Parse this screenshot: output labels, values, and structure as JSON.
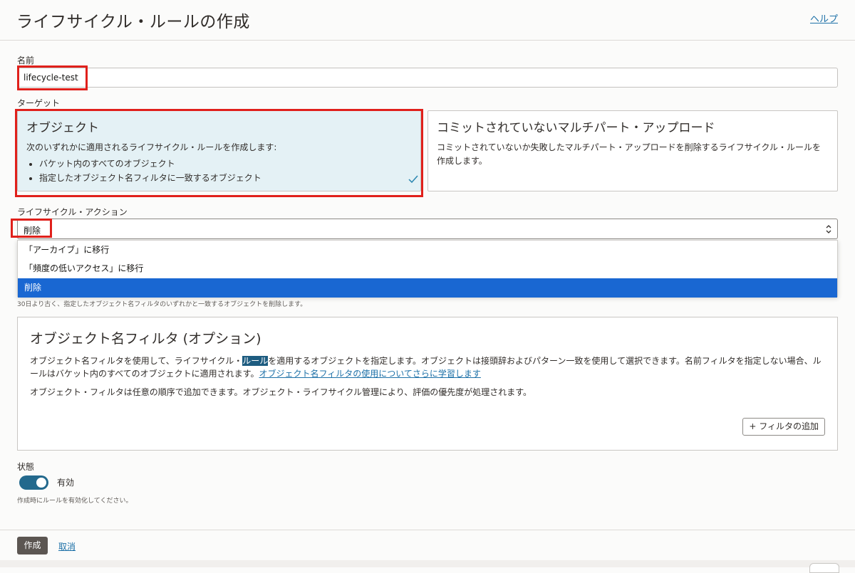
{
  "header": {
    "title": "ライフサイクル・ルールの作成",
    "help": "ヘルプ"
  },
  "name_field": {
    "label": "名前",
    "value": "lifecycle-test"
  },
  "target": {
    "label": "ターゲット",
    "options": [
      {
        "title": "オブジェクト",
        "description": "次のいずれかに適用されるライフサイクル・ルールを作成します:",
        "bullets": [
          "バケット内のすべてのオブジェクト",
          "指定したオブジェクト名フィルタに一致するオブジェクト"
        ],
        "selected": true
      },
      {
        "title": "コミットされていないマルチパート・アップロード",
        "description": "コミットされていないか失敗したマルチパート・アップロードを削除するライフサイクル・ルールを作成します。",
        "selected": false
      }
    ]
  },
  "action": {
    "label": "ライフサイクル・アクション",
    "value": "削除",
    "options": [
      "「アーカイブ」に移行",
      "「頻度の低いアクセス」に移行",
      "削除"
    ],
    "helper": "30日より古く、指定したオブジェクト名フィルタのいずれかと一致するオブジェクトを削除します。"
  },
  "filter_panel": {
    "title": "オブジェクト名フィルタ (オプション)",
    "text1_a": "オブジェクト名フィルタを使用して、ライフサイクル・",
    "text1_hl": "ルール",
    "text1_b": "を適用するオブジェクトを指定します。オブジェクトは接頭辞およびパターン一致を使用して選択できます。名前フィルタを指定しない場合、ルールはバケット内のすべてのオブジェクトに適用されます。",
    "link": "オブジェクト名フィルタの使用についてさらに学習します",
    "text2": "オブジェクト・フィルタは任意の順序で追加できます。オブジェクト・ライフサイクル管理により、評価の優先度が処理されます。",
    "add_button": "+ フィルタの追加"
  },
  "status": {
    "label": "状態",
    "toggle_label": "有効",
    "enabled": true,
    "helper": "作成時にルールを有効化してください。"
  },
  "footer": {
    "create": "作成",
    "cancel": "取消"
  },
  "colors": {
    "accent": "#23698d",
    "selected_option": "#1967d2",
    "highlight_box": "#e0201b",
    "selected_card": "#e4f1f5"
  }
}
